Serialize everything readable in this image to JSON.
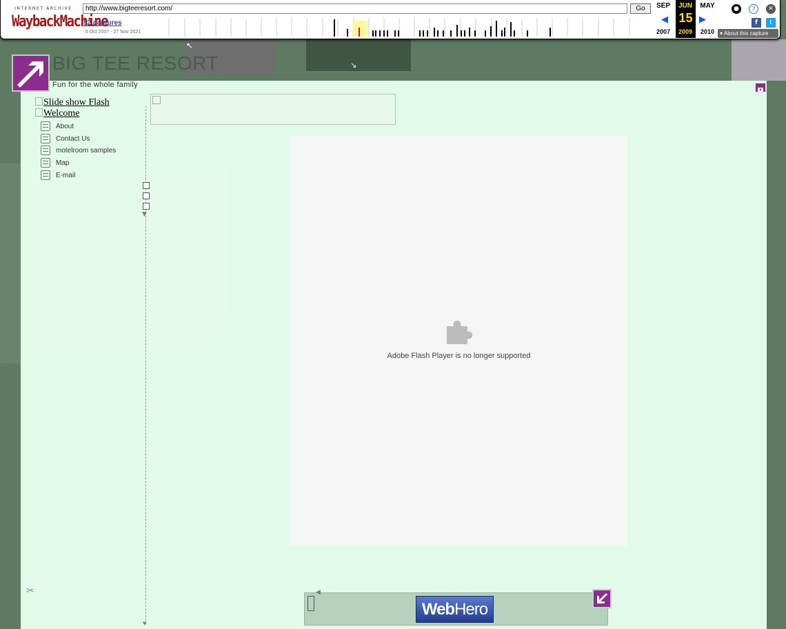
{
  "wayback": {
    "ia_label": "INTERNET ARCHIVE",
    "logo_text": "WaybackMachine",
    "url": "http://www.bigteeresort.com/",
    "go_label": "Go",
    "captures_label": "52 captures",
    "date_range": "6 Oct 2007 - 27 Nov 2021",
    "prev_month": "SEP",
    "current_month": "JUN",
    "next_month": "MAY",
    "current_day": "15",
    "prev_year": "2007",
    "current_year": "2009",
    "next_year": "2010",
    "about_label": "About this capture"
  },
  "site": {
    "title": "BIG TEE RESORT",
    "subtitle": "Fun for the whole family",
    "top_links": [
      {
        "label": "Slide show Flash"
      },
      {
        "label": "Welcome"
      }
    ],
    "nav": [
      {
        "label": "About"
      },
      {
        "label": "Contact Us"
      },
      {
        "label": "motelroom samples"
      },
      {
        "label": "Map"
      },
      {
        "label": "E-mail"
      }
    ],
    "flash_message": "Adobe Flash Player is no longer supported",
    "footer_brand_bold": "Web",
    "footer_brand_light": "Hero"
  },
  "colors": {
    "accent_purple": "#8c2c8f",
    "page_green": "#5e7a61",
    "content_bg": "#e2fae9",
    "wayback_red": "#a21a1a",
    "wayback_blue": "#2e45b0"
  }
}
